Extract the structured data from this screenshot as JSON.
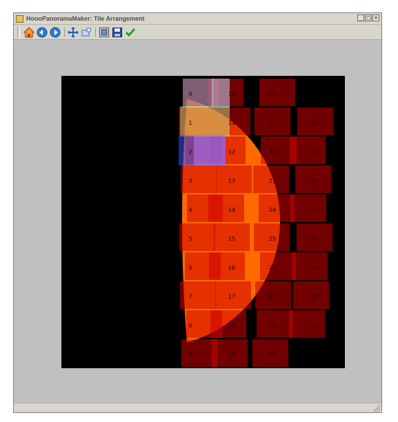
{
  "window": {
    "title": "HoooPanoramaMaker: Tile Arrangement",
    "buttons": [
      "_",
      "□",
      "×"
    ]
  },
  "toolbar": {
    "buttons": [
      {
        "name": "home",
        "icon": "home-icon"
      },
      {
        "name": "back",
        "icon": "back-arrow-icon"
      },
      {
        "name": "forward",
        "icon": "forward-arrow-icon"
      },
      {
        "name": "pan",
        "icon": "move-cross-icon"
      },
      {
        "name": "zoom",
        "icon": "zoom-icon"
      },
      {
        "name": "configure",
        "icon": "configure-subplots-icon"
      },
      {
        "name": "save",
        "icon": "floppy-save-icon"
      },
      {
        "name": "ok",
        "icon": "checkmark-icon"
      }
    ]
  },
  "plot": {
    "background": "#000000",
    "disk_color": "#ff6a00",
    "tile_color": "#d00000",
    "tile_labels": [
      "0",
      "1",
      "2",
      "3",
      "4",
      "5",
      "6",
      "7",
      "8",
      "9",
      "10",
      "11",
      "12",
      "13",
      "14",
      "15",
      "16",
      "17",
      "18",
      "19",
      "20",
      "21",
      "22",
      "23",
      "24",
      "25",
      "26",
      "27",
      "28",
      "29",
      "30",
      "31",
      "32",
      "33",
      "34",
      "35",
      "36",
      "37"
    ],
    "columns": [
      {
        "tiles": [
          "0",
          "1",
          "2",
          "3",
          "4",
          "5",
          "6",
          "7",
          "8",
          "9"
        ]
      },
      {
        "tiles": [
          "10",
          "11",
          "12",
          "13",
          "14",
          "15",
          "16",
          "17",
          "18",
          "19"
        ]
      },
      {
        "tiles": [
          "20",
          "21",
          "22",
          "23",
          "24",
          "25",
          "26",
          "27",
          "28",
          "29"
        ]
      },
      {
        "tiles": [
          "30",
          "31",
          "32",
          "33",
          "34",
          "35",
          "36",
          "37"
        ]
      }
    ]
  }
}
